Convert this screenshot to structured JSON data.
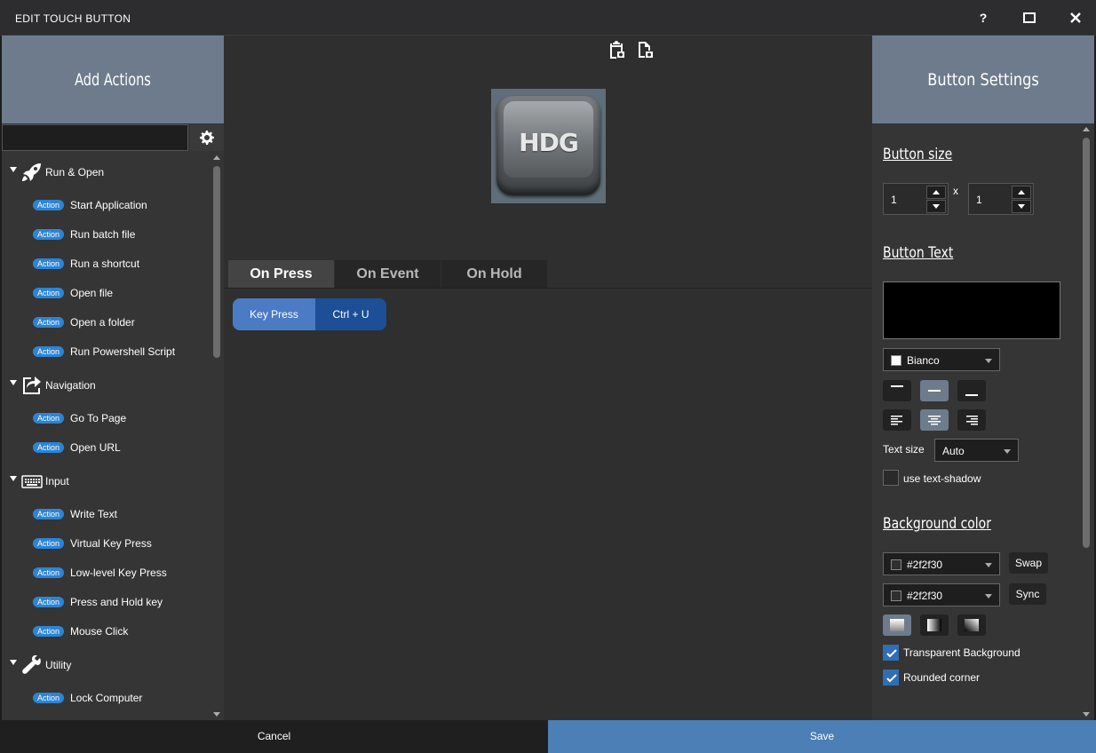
{
  "window": {
    "title": "EDIT TOUCH BUTTON",
    "help": "?"
  },
  "left": {
    "title": "Add Actions",
    "search_placeholder": "",
    "categories": [
      {
        "label": "Run & Open",
        "icon": "rocket-icon"
      },
      {
        "label": "Navigation",
        "icon": "share-arrow-icon"
      },
      {
        "label": "Input",
        "icon": "keyboard-icon"
      },
      {
        "label": "Utility",
        "icon": "wrench-icon"
      }
    ],
    "badge": "Action",
    "items": [
      "Start Application",
      "Run batch file",
      "Run a shortcut",
      "Open file",
      "Open a folder",
      "Run Powershell Script",
      "Go To Page",
      "Open URL",
      "Write Text",
      "Virtual Key Press",
      "Low-level Key Press",
      "Press and Hold key",
      "Mouse Click",
      "Lock Computer"
    ]
  },
  "center": {
    "preview_text": "HDG",
    "tabs": [
      "On Press",
      "On Event",
      "On Hold"
    ],
    "action": {
      "type": "Key Press",
      "value": "Ctrl + U"
    }
  },
  "right": {
    "title": "Button Settings",
    "button_size": {
      "title": "Button size",
      "width": "1",
      "height": "1",
      "sep": "x"
    },
    "button_text": {
      "title": "Button Text",
      "color_name": "Bianco",
      "color": "#ffffff",
      "text_size_label": "Text size",
      "text_size_value": "Auto",
      "shadow_label": "use text-shadow"
    },
    "background": {
      "title": "Background color",
      "color1": "#2f2f30",
      "color1_label": "#2f2f30",
      "color2": "#2f2f30",
      "color2_label": "#2f2f30",
      "swap": "Swap",
      "sync": "Sync",
      "transparent_label": "Transparent Background",
      "rounded_label": "Rounded corner"
    }
  },
  "footer": {
    "cancel": "Cancel",
    "save": "Save"
  },
  "colors": {
    "header": "#6d7b8c",
    "accent": "#4b7fb5",
    "badge": "#2d84d4"
  }
}
